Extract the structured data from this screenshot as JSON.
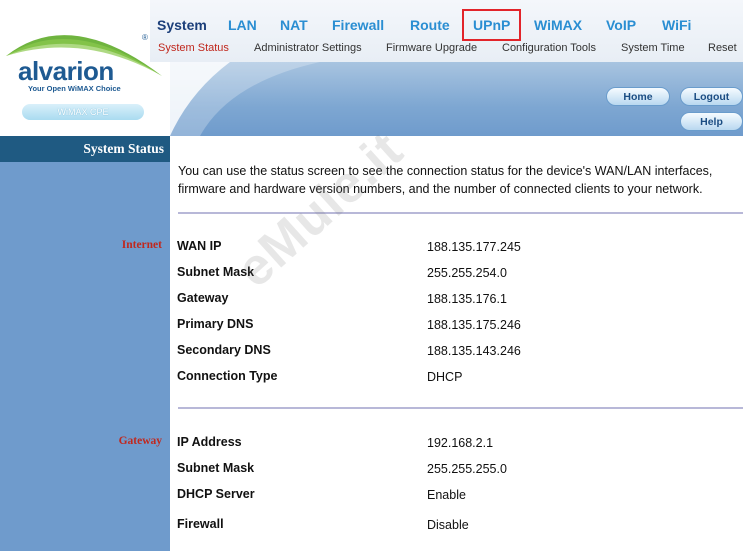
{
  "logo": {
    "brand": "alvarion",
    "registered": "®",
    "tagline": "Your Open WiMAX Choice",
    "product": "WiMAX CPE"
  },
  "nav": {
    "items": [
      "System",
      "LAN",
      "NAT",
      "Firewall",
      "Route",
      "UPnP",
      "WiMAX",
      "VoIP",
      "WiFi"
    ],
    "selected": "UPnP",
    "sub_items": [
      "System Status",
      "Administrator Settings",
      "Firmware Upgrade",
      "Configuration Tools",
      "System Time",
      "Reset"
    ],
    "active_sub": "System Status"
  },
  "buttons": {
    "home": "Home",
    "logout": "Logout",
    "help": "Help"
  },
  "sidebar": {
    "heading": "System Status"
  },
  "intro": "You can use the status screen to see the connection status for the device's WAN/LAN interfaces, firmware  and hardware version numbers, and the number of connected clients to your network.",
  "sections": {
    "internet": {
      "label": "Internet",
      "rows": [
        {
          "label": "WAN IP",
          "value": "188.135.177.245"
        },
        {
          "label": "Subnet Mask",
          "value": "255.255.254.0"
        },
        {
          "label": "Gateway",
          "value": "188.135.176.1"
        },
        {
          "label": "Primary DNS",
          "value": "188.135.175.246"
        },
        {
          "label": "Secondary DNS",
          "value": "188.135.143.246"
        },
        {
          "label": "Connection Type",
          "value": "DHCP"
        }
      ]
    },
    "gateway": {
      "label": "Gateway",
      "rows": [
        {
          "label": "IP Address",
          "value": "192.168.2.1"
        },
        {
          "label": "Subnet Mask",
          "value": "255.255.255.0"
        },
        {
          "label": "DHCP Server",
          "value": "Enable"
        },
        {
          "label": "Firewall",
          "value": "Disable"
        }
      ]
    }
  },
  "watermark": "eMule.it",
  "colors": {
    "nav_link": "#2a8ed2",
    "nav_system": "#1c3f7a",
    "sidebar": "#6f9bcc",
    "sidebar_heading": "#1f5a82",
    "section_label": "#c0281e",
    "selected_outline": "#e2242a"
  }
}
